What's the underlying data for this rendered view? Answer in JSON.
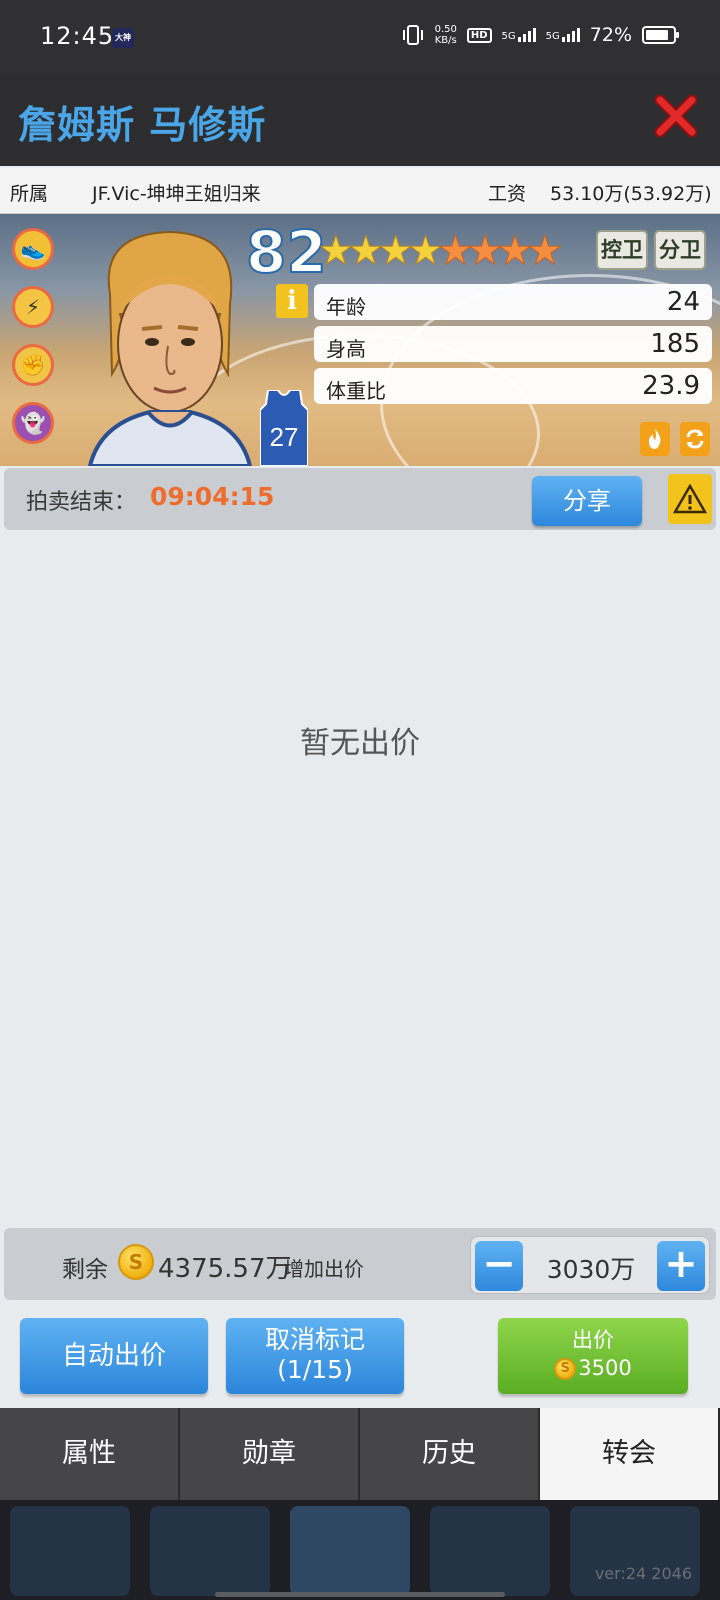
{
  "status_bar": {
    "time": "12:45",
    "app_icon": "大神",
    "net_speed_value": "0.50",
    "net_speed_unit": "KB/s",
    "hd_label": "HD",
    "net1": "5G",
    "net2": "5G",
    "battery": "72%"
  },
  "header": {
    "player_name": "詹姆斯 马修斯",
    "close_icon": "close-x-icon"
  },
  "info_row": {
    "team_label": "所属",
    "team_value": "JF.Vic-坤坤王姐归来",
    "salary_label": "工资",
    "salary_value": "53.10万(53.92万)"
  },
  "player_card": {
    "rating": "82",
    "stars_gold": 4,
    "stars_orange": 4,
    "positions": [
      "控卫",
      "分卫"
    ],
    "jersey_number": "27",
    "info_icon": "i",
    "stats": [
      {
        "label": "年龄",
        "value": "24"
      },
      {
        "label": "身高",
        "value": "185"
      },
      {
        "label": "体重比",
        "value": "23.9"
      }
    ],
    "badge_icons": [
      "sneaker-badge-icon",
      "lightning-badge-icon",
      "fist-badge-icon",
      "ghost-badge-icon"
    ]
  },
  "auction": {
    "end_label": "拍卖结束：",
    "countdown": "09:04:15",
    "share_label": "分享"
  },
  "bids": {
    "empty_text": "暂无出价"
  },
  "bid_controls": {
    "remain_label": "剩余",
    "coin_symbol": "S",
    "remain_value": "4375.57万",
    "add_label": "增加出价",
    "minus": "−",
    "plus": "+",
    "step_value": "3030万"
  },
  "actions": {
    "auto_bid": "自动出价",
    "unmark_line1": "取消标记",
    "unmark_line2": "(1/15)",
    "bid_label": "出价",
    "bid_price": "3500"
  },
  "tabs": [
    "属性",
    "勋章",
    "历史",
    "转会"
  ],
  "active_tab": 3,
  "footer": {
    "version": "ver:24  2046"
  },
  "colors": {
    "header_name": "#4aa6e6",
    "countdown": "#ef6d2c",
    "blue_button": "#2e88dc",
    "green_button": "#5aad22"
  }
}
